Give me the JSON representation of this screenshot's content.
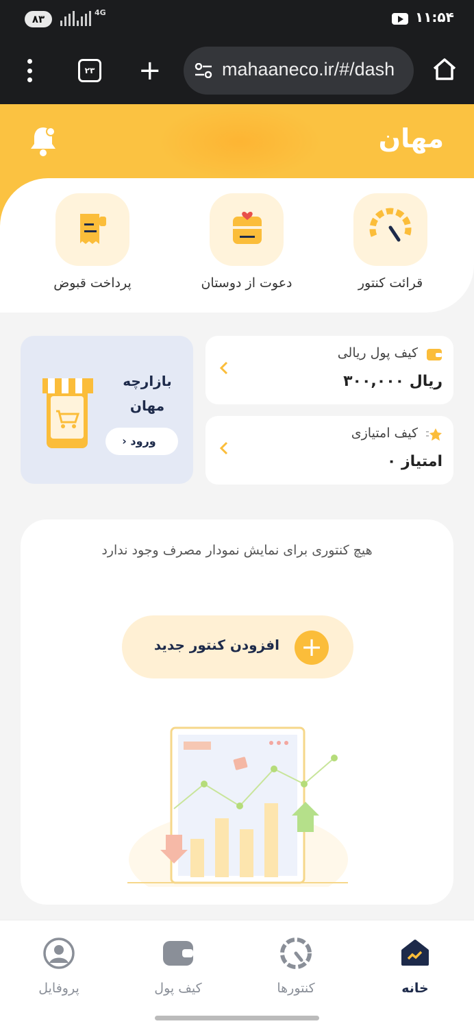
{
  "status_bar": {
    "battery": "۸۳",
    "network": "4G",
    "time": "۱۱:۵۴",
    "icons": [
      "signal-icon",
      "signal-icon",
      "youtube-icon"
    ]
  },
  "browser": {
    "tab_count": "۲۳",
    "url": "mahaaneco.ir/#/dash",
    "icons": [
      "menu-kebab-icon",
      "tabs-icon",
      "new-tab-plus-icon",
      "site-settings-icon",
      "home-icon"
    ]
  },
  "header": {
    "logo": "مهان",
    "bell_icon": "bell-icon"
  },
  "shortcuts": [
    {
      "label": "قرائت کنتور",
      "icon": "gauge-icon"
    },
    {
      "label": "دعوت از دوستان",
      "icon": "gift-heart-icon"
    },
    {
      "label": "پرداخت قبوض",
      "icon": "receipt-icon"
    }
  ],
  "wallets": {
    "rial": {
      "title": "کیف پول ریالی",
      "amount": "۳۰۰,۰۰۰ ریال",
      "icon": "wallet-icon"
    },
    "points": {
      "title": "کیف امتیازی",
      "amount": "۰ امتیاز",
      "icon": "star-icon"
    }
  },
  "bazaar": {
    "title_line1": "بازارچه",
    "title_line2": "مهان",
    "enter_label": "ورود",
    "icon": "shop-cart-icon"
  },
  "consumption": {
    "empty_message": "هیچ کنتوری برای نمایش نمودار مصرف وجود ندارد",
    "add_button_label": "افزودن کنتور جدید",
    "add_icon": "plus-icon",
    "plus_glyph": "+"
  },
  "bottom_nav": [
    {
      "label": "خانه",
      "icon": "home-chart-icon",
      "active": true
    },
    {
      "label": "کنتورها",
      "icon": "meter-icon",
      "active": false
    },
    {
      "label": "کیف پول",
      "icon": "wallet-icon",
      "active": false
    },
    {
      "label": "پروفایل",
      "icon": "profile-icon",
      "active": false
    }
  ],
  "colors": {
    "brand_yellow": "#fbc241",
    "navy": "#1d2a4a",
    "bazaar_bg": "#e4e9f5",
    "soft_yellow": "#fff3db"
  }
}
